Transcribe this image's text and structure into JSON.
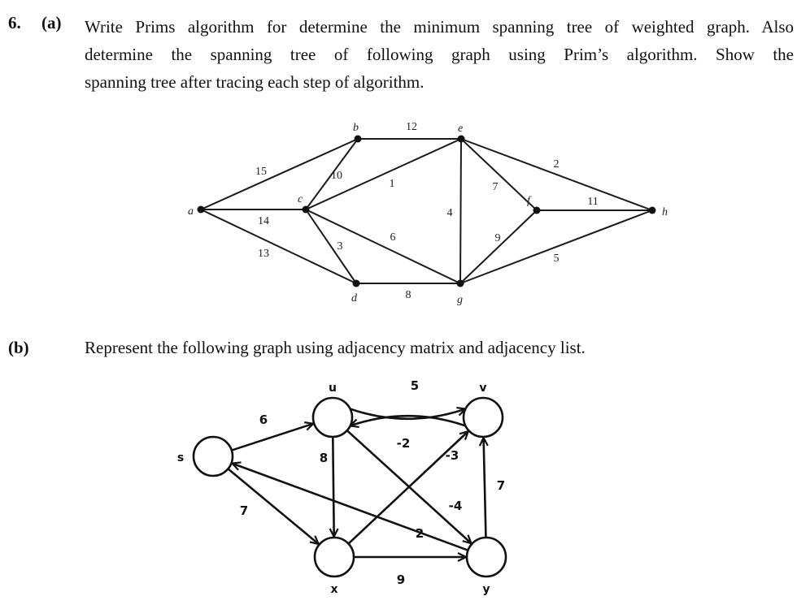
{
  "question": {
    "number": "6.",
    "part_a": {
      "label": "(a)",
      "lines": [
        "Write Prims algorithm for determine the minimum spanning tree of weighted graph. Also",
        "determine the spanning tree of following graph using Prim’s algorithm. Show the",
        "spanning tree after tracing each step of algorithm."
      ]
    },
    "part_b": {
      "label": "(b)",
      "text": "Represent the following graph using adjacency matrix and adjacency list."
    }
  },
  "graph_a": {
    "type": "undirected-weighted",
    "nodes": [
      "a",
      "b",
      "c",
      "d",
      "e",
      "f",
      "g",
      "h"
    ],
    "edges": [
      {
        "from": "a",
        "to": "b",
        "weight": "15"
      },
      {
        "from": "a",
        "to": "c",
        "weight": "14"
      },
      {
        "from": "a",
        "to": "d",
        "weight": "13"
      },
      {
        "from": "c",
        "to": "b",
        "weight": "10"
      },
      {
        "from": "c",
        "to": "e",
        "weight": "1"
      },
      {
        "from": "c",
        "to": "d",
        "weight": "3"
      },
      {
        "from": "c",
        "to": "g",
        "weight": "6"
      },
      {
        "from": "b",
        "to": "e",
        "weight": "12"
      },
      {
        "from": "d",
        "to": "g",
        "weight": "8"
      },
      {
        "from": "e",
        "to": "g",
        "weight": "4"
      },
      {
        "from": "e",
        "to": "f",
        "weight": "7"
      },
      {
        "from": "e",
        "to": "h",
        "weight": "2"
      },
      {
        "from": "g",
        "to": "f",
        "weight": "9"
      },
      {
        "from": "g",
        "to": "h",
        "weight": "5"
      },
      {
        "from": "f",
        "to": "h",
        "weight": "11"
      }
    ]
  },
  "graph_b": {
    "type": "directed-weighted",
    "nodes": [
      "s",
      "u",
      "v",
      "x",
      "y"
    ],
    "edges": [
      {
        "from": "s",
        "to": "u",
        "weight": "6"
      },
      {
        "from": "s",
        "to": "x",
        "weight": "7"
      },
      {
        "from": "y",
        "to": "s",
        "weight": "2"
      },
      {
        "from": "u",
        "to": "v",
        "weight": "5"
      },
      {
        "from": "v",
        "to": "u",
        "weight": "-2"
      },
      {
        "from": "u",
        "to": "x",
        "weight": "8"
      },
      {
        "from": "u",
        "to": "y",
        "weight": "-4"
      },
      {
        "from": "x",
        "to": "v",
        "weight": "-3"
      },
      {
        "from": "x",
        "to": "y",
        "weight": "9"
      },
      {
        "from": "y",
        "to": "v",
        "weight": "7"
      }
    ]
  }
}
